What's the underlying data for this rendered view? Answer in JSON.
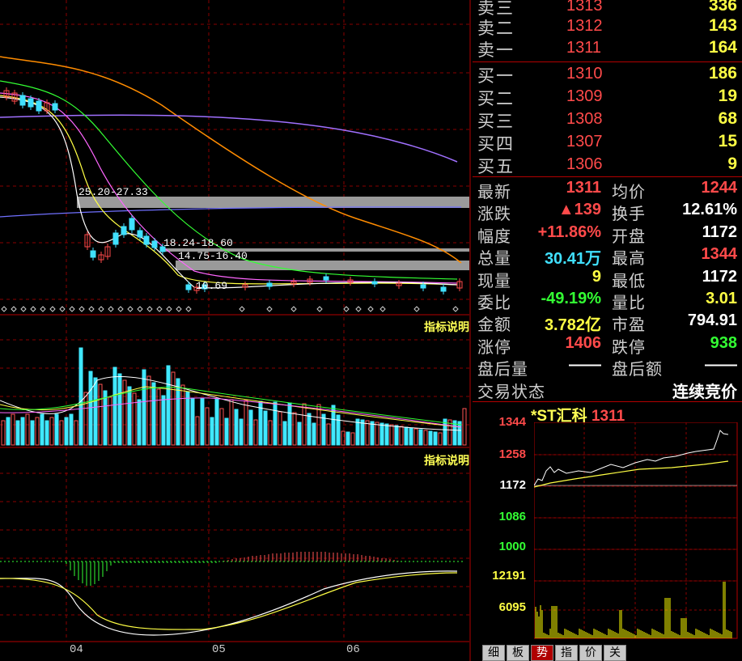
{
  "order_book": {
    "asks": [
      {
        "label": "卖三",
        "price": "1313",
        "volume": "336"
      },
      {
        "label": "卖二",
        "price": "1312",
        "volume": "143"
      },
      {
        "label": "卖一",
        "price": "1311",
        "volume": "164"
      }
    ],
    "bids": [
      {
        "label": "买一",
        "price": "1310",
        "volume": "186"
      },
      {
        "label": "买二",
        "price": "1309",
        "volume": "19"
      },
      {
        "label": "买三",
        "price": "1308",
        "volume": "68"
      },
      {
        "label": "买四",
        "price": "1307",
        "volume": "15"
      },
      {
        "label": "买五",
        "price": "1306",
        "volume": "9"
      }
    ]
  },
  "quote": {
    "rows": [
      {
        "l1": "最新",
        "v1": "1311",
        "c1": "red",
        "l2": "均价",
        "v2": "1244",
        "c2": "red"
      },
      {
        "l1": "涨跌",
        "v1": "▲139",
        "c1": "red",
        "l2": "换手",
        "v2": "12.61%",
        "c2": "white"
      },
      {
        "l1": "幅度",
        "v1": "+11.86%",
        "c1": "red",
        "l2": "开盘",
        "v2": "1172",
        "c2": "white"
      },
      {
        "l1": "总量",
        "v1": "30.41万",
        "c1": "cyan",
        "l2": "最高",
        "v2": "1344",
        "c2": "red"
      },
      {
        "l1": "现量",
        "v1": "9",
        "c1": "yellow",
        "l2": "最低",
        "v2": "1172",
        "c2": "white"
      },
      {
        "l1": "委比",
        "v1": "-49.19%",
        "c1": "green",
        "l2": "量比",
        "v2": "3.01",
        "c2": "yellow"
      },
      {
        "l1": "金额",
        "v1": "3.782亿",
        "c1": "yellow",
        "l2": "市盈",
        "v2": "794.91",
        "c2": "white"
      },
      {
        "l1": "涨停",
        "v1": "1406",
        "c1": "red",
        "l2": "跌停",
        "v2": "938",
        "c2": "green"
      },
      {
        "l1": "盘后量",
        "v1": "——",
        "c1": "white",
        "l2": "盘后额",
        "v2": "——",
        "c2": "white"
      }
    ],
    "trade_state_label": "交易状态",
    "trade_state_value": "连续竞价"
  },
  "mini_chart": {
    "title_name": "*ST汇科",
    "title_price": "1311",
    "price_ticks": [
      "1344",
      "1258",
      "1172",
      "1086",
      "1000"
    ],
    "volume_ticks": [
      "12191",
      "6095"
    ]
  },
  "tabs": [
    "细",
    "板",
    "势",
    "指",
    "价",
    "关"
  ],
  "active_tab": 2,
  "main_chart": {
    "indicator_label_1": "指标说明",
    "indicator_label_2": "指标说明",
    "months": [
      "04",
      "05",
      "06"
    ],
    "zones": [
      "25.20-27.33",
      "18.24-18.60",
      "14.75-16.40",
      "10.69"
    ]
  },
  "colors": {
    "up": "#ff4a4a",
    "down": "#40e0ff",
    "grid": "#8a0000",
    "volume_up": "#ff5555",
    "volume_down": "#40e8ff"
  }
}
